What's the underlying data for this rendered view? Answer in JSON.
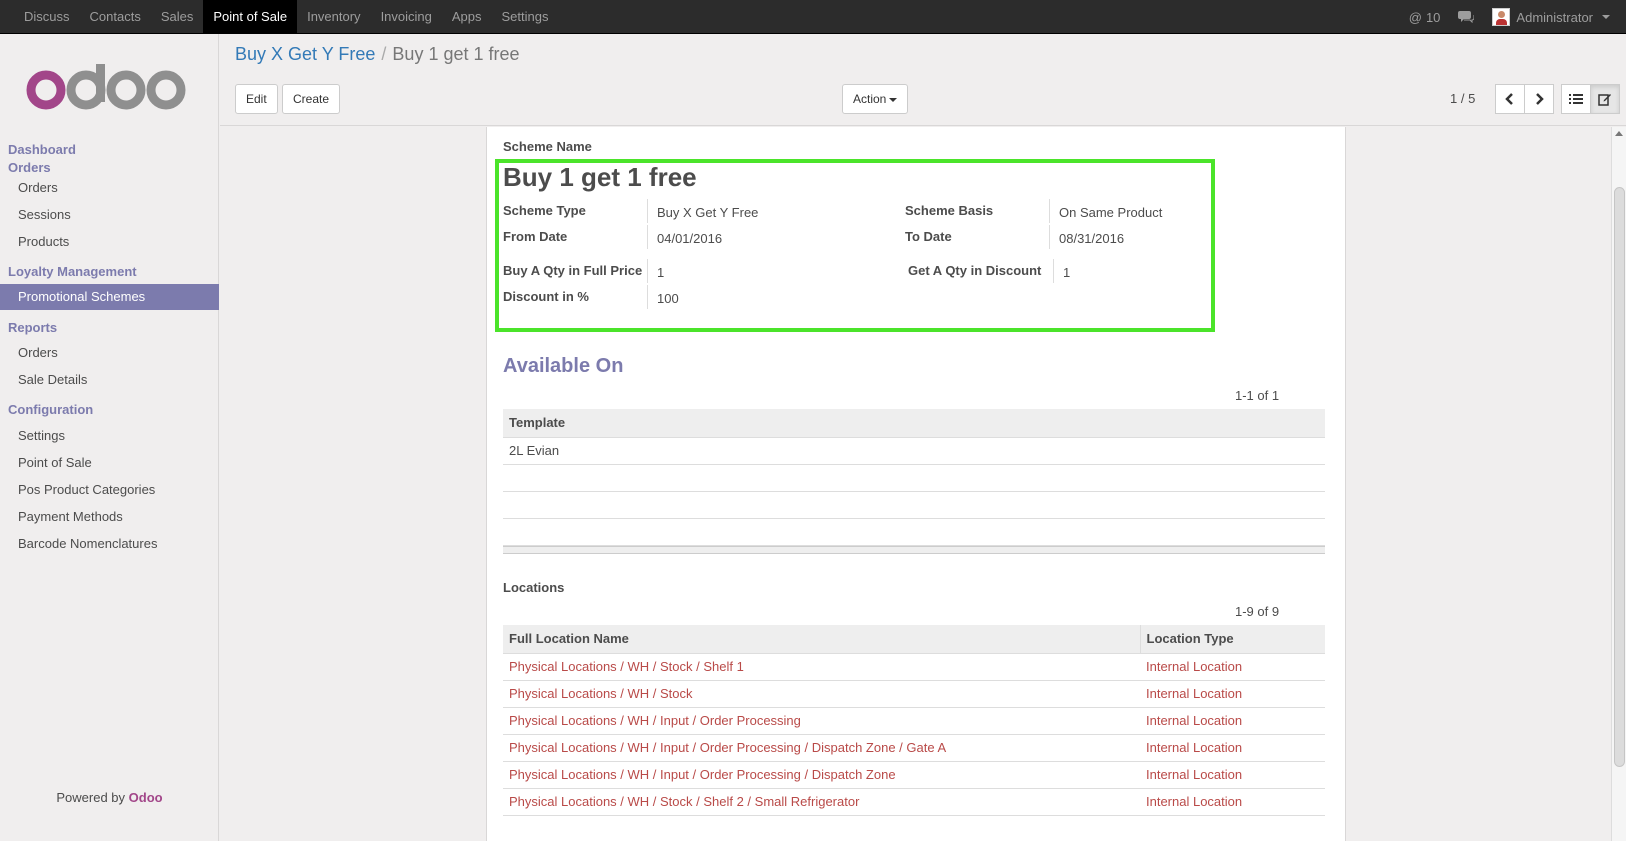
{
  "topbar": {
    "menu": [
      "Discuss",
      "Contacts",
      "Sales",
      "Point of Sale",
      "Inventory",
      "Invoicing",
      "Apps",
      "Settings"
    ],
    "active_index": 3,
    "mentions": "10",
    "user": "Administrator"
  },
  "sidebar": {
    "sections": {
      "dashboard": "Dashboard",
      "orders": "Orders",
      "loyalty": "Loyalty Management",
      "reports": "Reports",
      "configuration": "Configuration"
    },
    "orders_items": [
      "Orders",
      "Sessions",
      "Products"
    ],
    "loyalty_items": [
      "Promotional Schemes"
    ],
    "reports_items": [
      "Orders",
      "Sale Details"
    ],
    "config_items": [
      "Settings",
      "Point of Sale",
      "Pos Product Categories",
      "Payment Methods",
      "Barcode Nomenclatures"
    ],
    "powered_prefix": "Powered by",
    "powered_brand": "Odoo"
  },
  "control": {
    "breadcrumb_parent": "Buy X Get Y Free",
    "breadcrumb_separator": "/",
    "breadcrumb_current": "Buy 1 get 1 free",
    "edit_label": "Edit",
    "create_label": "Create",
    "action_label": "Action",
    "pager": "1 / 5"
  },
  "form": {
    "scheme_name_label": "Scheme Name",
    "scheme_name": "Buy 1 get 1 free",
    "scheme_type_label": "Scheme Type",
    "scheme_type": "Buy X Get Y Free",
    "scheme_basis_label": "Scheme Basis",
    "scheme_basis": "On Same Product",
    "from_date_label": "From Date",
    "from_date": "04/01/2016",
    "to_date_label": "To Date",
    "to_date": "08/31/2016",
    "buy_qty_label": "Buy A Qty in Full Price",
    "buy_qty": "1",
    "get_qty_label": "Get A Qty in Discount",
    "get_qty": "1",
    "discount_label": "Discount in %",
    "discount": "100",
    "available_on_title": "Available On",
    "template_count": "1-1 of 1",
    "template_header": "Template",
    "templates": [
      "2L Evian"
    ],
    "locations_title": "Locations",
    "locations_count": "1-9 of 9",
    "locations_headers": {
      "name": "Full Location Name",
      "type": "Location Type"
    },
    "locations": [
      {
        "name": "Physical Locations / WH / Stock / Shelf 1",
        "type": "Internal Location"
      },
      {
        "name": "Physical Locations / WH / Stock",
        "type": "Internal Location"
      },
      {
        "name": "Physical Locations / WH / Input / Order Processing",
        "type": "Internal Location"
      },
      {
        "name": "Physical Locations / WH / Input / Order Processing / Dispatch Zone / Gate A",
        "type": "Internal Location"
      },
      {
        "name": "Physical Locations / WH / Input / Order Processing / Dispatch Zone",
        "type": "Internal Location"
      },
      {
        "name": "Physical Locations / WH / Stock / Shelf 2 / Small Refrigerator",
        "type": "Internal Location"
      }
    ]
  },
  "colors": {
    "brand_purple": "#7c7bad",
    "highlight_green": "#4be42a",
    "link_red": "#b94a48",
    "link_blue": "#337ab7"
  }
}
